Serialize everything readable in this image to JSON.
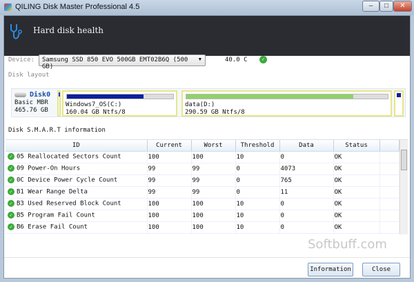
{
  "window": {
    "title": "QILING Disk Master Professional 4.5",
    "minimize": "–",
    "maximize": "□",
    "close": "✕"
  },
  "header": {
    "title": "Hard disk health",
    "icon": "stethoscope-icon"
  },
  "device": {
    "label": "Device:",
    "selected": "Samsung SSD 850 EVO 500GB EMT02B6Q (500 GB)",
    "temperature": "40.0 C",
    "status": "ok"
  },
  "layout": {
    "label": "Disk layout",
    "disk": {
      "name": "Disk0",
      "type": "Basic MBR",
      "size": "465.76 GB"
    },
    "partitions": [
      {
        "name": "Windows7_OS(C:)",
        "info": "160.04 GB Ntfs/8",
        "used_fraction": 0.72,
        "color": "#0b1fa0"
      },
      {
        "name": "data(D:)",
        "info": "290.59 GB Ntfs/8",
        "used_fraction": 0.83,
        "color": "#8fd16a"
      }
    ]
  },
  "smart": {
    "label": "Disk S.M.A.R.T information",
    "columns": [
      "ID",
      "Current",
      "Worst",
      "Threshold",
      "Data",
      "Status"
    ],
    "rows": [
      [
        "05 Reallocated Sectors Count",
        "100",
        "100",
        "10",
        "0",
        "OK"
      ],
      [
        "09 Power-On Hours",
        "99",
        "99",
        "0",
        "4073",
        "OK"
      ],
      [
        "0C Device Power Cycle Count",
        "99",
        "99",
        "0",
        "765",
        "OK"
      ],
      [
        "B1 Wear Range Delta",
        "99",
        "99",
        "0",
        "11",
        "OK"
      ],
      [
        "B3 Used Reserved Block Count",
        "100",
        "100",
        "10",
        "0",
        "OK"
      ],
      [
        "B5 Program Fail Count",
        "100",
        "100",
        "10",
        "0",
        "OK"
      ],
      [
        "B6 Erase Fail Count",
        "100",
        "100",
        "10",
        "0",
        "OK"
      ]
    ]
  },
  "watermark": "Softbuff.com",
  "buttons": {
    "information": "Information",
    "close": "Close"
  }
}
